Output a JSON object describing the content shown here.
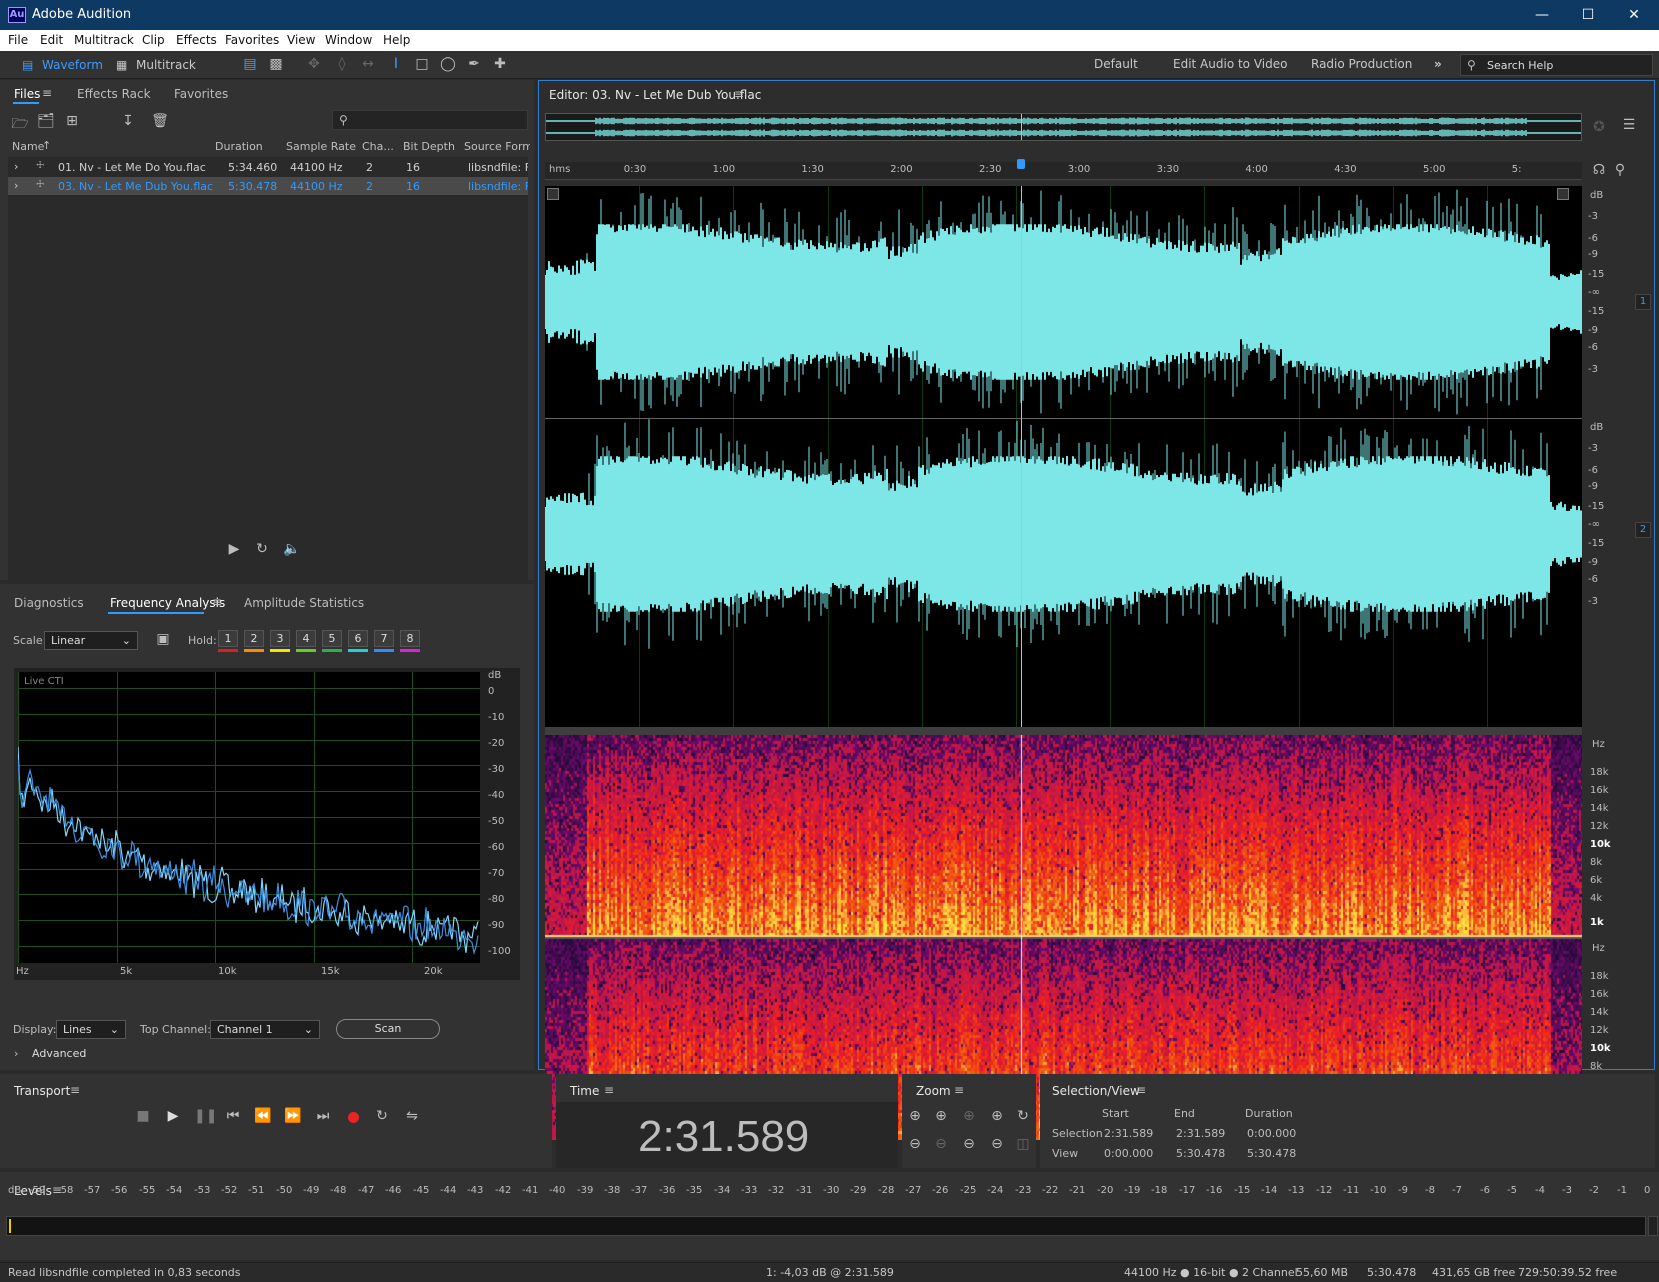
{
  "window": {
    "title": "Adobe Audition",
    "logo": "Au",
    "min_icon": "minimize-icon",
    "max_icon": "maximize-icon",
    "close_icon": "close-icon"
  },
  "menu": [
    "File",
    "Edit",
    "Multitrack",
    "Clip",
    "Effects",
    "Favorites",
    "View",
    "Window",
    "Help"
  ],
  "toolbar": {
    "waveform": "Waveform",
    "multitrack": "Multitrack",
    "workspaces": [
      "Default",
      "Edit Audio to Video",
      "Radio Production"
    ],
    "more": "»",
    "search_placeholder": "Search Help"
  },
  "files_panel": {
    "tabs": [
      "Files",
      "Effects Rack",
      "Favorites"
    ],
    "columns": [
      "Name",
      "Duration",
      "Sample Rate",
      "Cha...",
      "Bit Depth",
      "Source Form..."
    ],
    "rows": [
      {
        "name": "01. Nv - Let Me Do You.flac",
        "duration": "5:34.460",
        "rate": "44100 Hz",
        "ch": "2",
        "bits": "16",
        "src": "libsndfile: FL"
      },
      {
        "name": "03. Nv - Let Me Dub You.flac",
        "duration": "5:30.478",
        "rate": "44100 Hz",
        "ch": "2",
        "bits": "16",
        "src": "libsndfile: FL"
      }
    ]
  },
  "analysis_panel": {
    "tabs": [
      "Diagnostics",
      "Frequency Analysis",
      "Amplitude Statistics"
    ],
    "scale_label": "Scale:",
    "scale_value": "Linear",
    "hold_label": "Hold:",
    "hold": [
      "1",
      "2",
      "3",
      "4",
      "5",
      "6",
      "7",
      "8"
    ],
    "hold_colors": [
      "#e51c1c",
      "#ff8a00",
      "#f5e400",
      "#5ed11b",
      "#26b34a",
      "#19d3e0",
      "#2d8cff",
      "#e21ce0"
    ],
    "live": "Live CTI",
    "db_axis": [
      "dB",
      "0",
      "-10",
      "-20",
      "-30",
      "-40",
      "-50",
      "-60",
      "-70",
      "-80",
      "-90",
      "-100"
    ],
    "hz_axis": [
      "Hz",
      "5k",
      "10k",
      "15k",
      "20k"
    ],
    "display_label": "Display:",
    "display_value": "Lines",
    "top_channel_label": "Top Channel:",
    "top_channel_value": "Channel 1",
    "scan": "Scan",
    "advanced": "Advanced"
  },
  "editor": {
    "title": "Editor: 03. Nv - Let Me Dub You.flac",
    "ruler": [
      "hms",
      "0:30",
      "1:00",
      "1:30",
      "2:00",
      "2:30",
      "3:00",
      "3:30",
      "4:00",
      "4:30",
      "5:00",
      "5:"
    ],
    "db_scale": [
      "dB",
      "-3",
      "-6",
      "-9",
      "-15",
      "-∞",
      "-15",
      "-9",
      "-6",
      "-3"
    ],
    "ch1": "1",
    "ch2": "2",
    "hz_scale": [
      "Hz",
      "18k",
      "16k",
      "14k",
      "12k",
      "10k",
      "8k",
      "6k",
      "4k",
      "1k"
    ],
    "playhead_fraction": 0.4592,
    "wave_color": "#7de7e7"
  },
  "transport": {
    "title": "Transport"
  },
  "time": {
    "title": "Time",
    "value": "2:31.589"
  },
  "zoom": {
    "title": "Zoom"
  },
  "selection": {
    "title": "Selection/View",
    "col_start": "Start",
    "col_end": "End",
    "col_dur": "Duration",
    "sel_label": "Selection",
    "view_label": "View",
    "sel_start": "2:31.589",
    "sel_end": "2:31.589",
    "sel_dur": "0:00.000",
    "view_start": "0:00.000",
    "view_end": "5:30.478",
    "view_dur": "5:30.478"
  },
  "levels": {
    "title": "Levels",
    "ticks": [
      "dB",
      "-59",
      "-58",
      "-57",
      "-56",
      "-55",
      "-54",
      "-53",
      "-52",
      "-51",
      "-50",
      "-49",
      "-48",
      "-47",
      "-46",
      "-45",
      "-44",
      "-43",
      "-42",
      "-41",
      "-40",
      "-39",
      "-38",
      "-37",
      "-36",
      "-35",
      "-34",
      "-33",
      "-32",
      "-31",
      "-30",
      "-29",
      "-28",
      "-27",
      "-26",
      "-25",
      "-24",
      "-23",
      "-22",
      "-21",
      "-20",
      "-19",
      "-18",
      "-17",
      "-16",
      "-15",
      "-14",
      "-13",
      "-12",
      "-11",
      "-10",
      "-9",
      "-8",
      "-7",
      "-6",
      "-5",
      "-4",
      "-3",
      "-2",
      "-1",
      "0"
    ]
  },
  "status": {
    "left": "Read libsndfile completed in 0,83 seconds",
    "cursor": "1: -4,03 dB @ 2:31.589",
    "format": "44100 Hz ● 16-bit ● 2 Channel",
    "size": "55,60 MB",
    "duration": "5:30.478",
    "free": "431,65 GB free",
    "free_time": "729:50:39.52 free"
  }
}
